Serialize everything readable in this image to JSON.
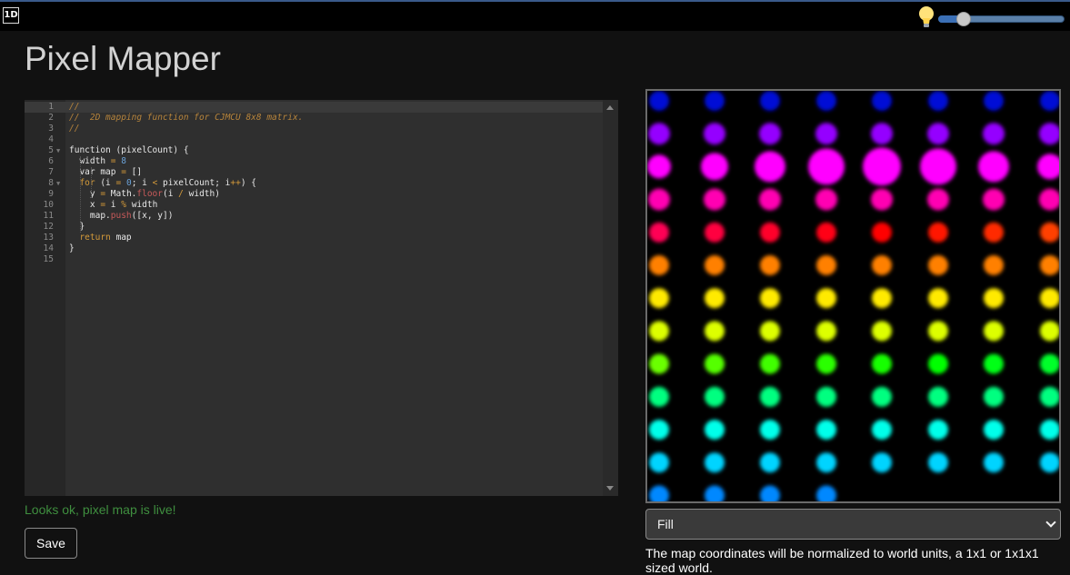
{
  "topbar": {
    "mode_label": "1D",
    "brightness_icon": "lightbulb-icon",
    "brightness": 0.13
  },
  "page_title": "Pixel Mapper",
  "editor": {
    "lines": [
      {
        "n": "1",
        "parts": [
          [
            "c",
            "//"
          ]
        ]
      },
      {
        "n": "2",
        "parts": [
          [
            "c",
            "//  2D mapping function for CJMCU 8x8 matrix."
          ]
        ]
      },
      {
        "n": "3",
        "parts": [
          [
            "c",
            "//"
          ]
        ]
      },
      {
        "n": "4",
        "parts": []
      },
      {
        "n": "5",
        "fold": true,
        "parts": [
          [
            "b",
            "function (pixelCount) {"
          ]
        ]
      },
      {
        "n": "6",
        "parts": [
          [
            "b",
            "  width "
          ],
          [
            "o",
            "="
          ],
          [
            "b",
            " "
          ],
          [
            "n",
            "8"
          ]
        ]
      },
      {
        "n": "7",
        "parts": [
          [
            "b",
            "  var map "
          ],
          [
            "o",
            "="
          ],
          [
            "b",
            " []"
          ]
        ]
      },
      {
        "n": "8",
        "fold": true,
        "parts": [
          [
            "k",
            "  for"
          ],
          [
            "b",
            " (i "
          ],
          [
            "o",
            "="
          ],
          [
            "b",
            " "
          ],
          [
            "n",
            "0"
          ],
          [
            "b",
            "; i "
          ],
          [
            "o",
            "<"
          ],
          [
            "b",
            " pixelCount; i"
          ],
          [
            "o",
            "++"
          ],
          [
            "b",
            ") {"
          ]
        ]
      },
      {
        "n": "9",
        "parts": [
          [
            "b",
            "    y "
          ],
          [
            "o",
            "="
          ],
          [
            "b",
            " Math."
          ],
          [
            "p",
            "floor"
          ],
          [
            "b",
            "(i "
          ],
          [
            "o",
            "/"
          ],
          [
            "b",
            " width)"
          ]
        ]
      },
      {
        "n": "10",
        "parts": [
          [
            "b",
            "    x "
          ],
          [
            "o",
            "="
          ],
          [
            "b",
            " i "
          ],
          [
            "o",
            "%"
          ],
          [
            "b",
            " width"
          ]
        ]
      },
      {
        "n": "11",
        "parts": [
          [
            "b",
            "    map."
          ],
          [
            "p",
            "push"
          ],
          [
            "b",
            "([x, y])"
          ]
        ]
      },
      {
        "n": "12",
        "parts": [
          [
            "b",
            "  }"
          ]
        ]
      },
      {
        "n": "13",
        "parts": [
          [
            "k",
            "  return"
          ],
          [
            "b",
            " map"
          ]
        ]
      },
      {
        "n": "14",
        "parts": [
          [
            "b",
            "}"
          ]
        ]
      },
      {
        "n": "15",
        "parts": []
      }
    ]
  },
  "status_message": "Looks ok, pixel map is live!",
  "save_label": "Save",
  "preview": {
    "columns": 8,
    "rows": 13,
    "pixel_count": 100
  },
  "mode_select": {
    "selected": "Fill"
  },
  "note": "The map coordinates will be normalized to world units, a 1x1 or 1x1x1 sized world."
}
